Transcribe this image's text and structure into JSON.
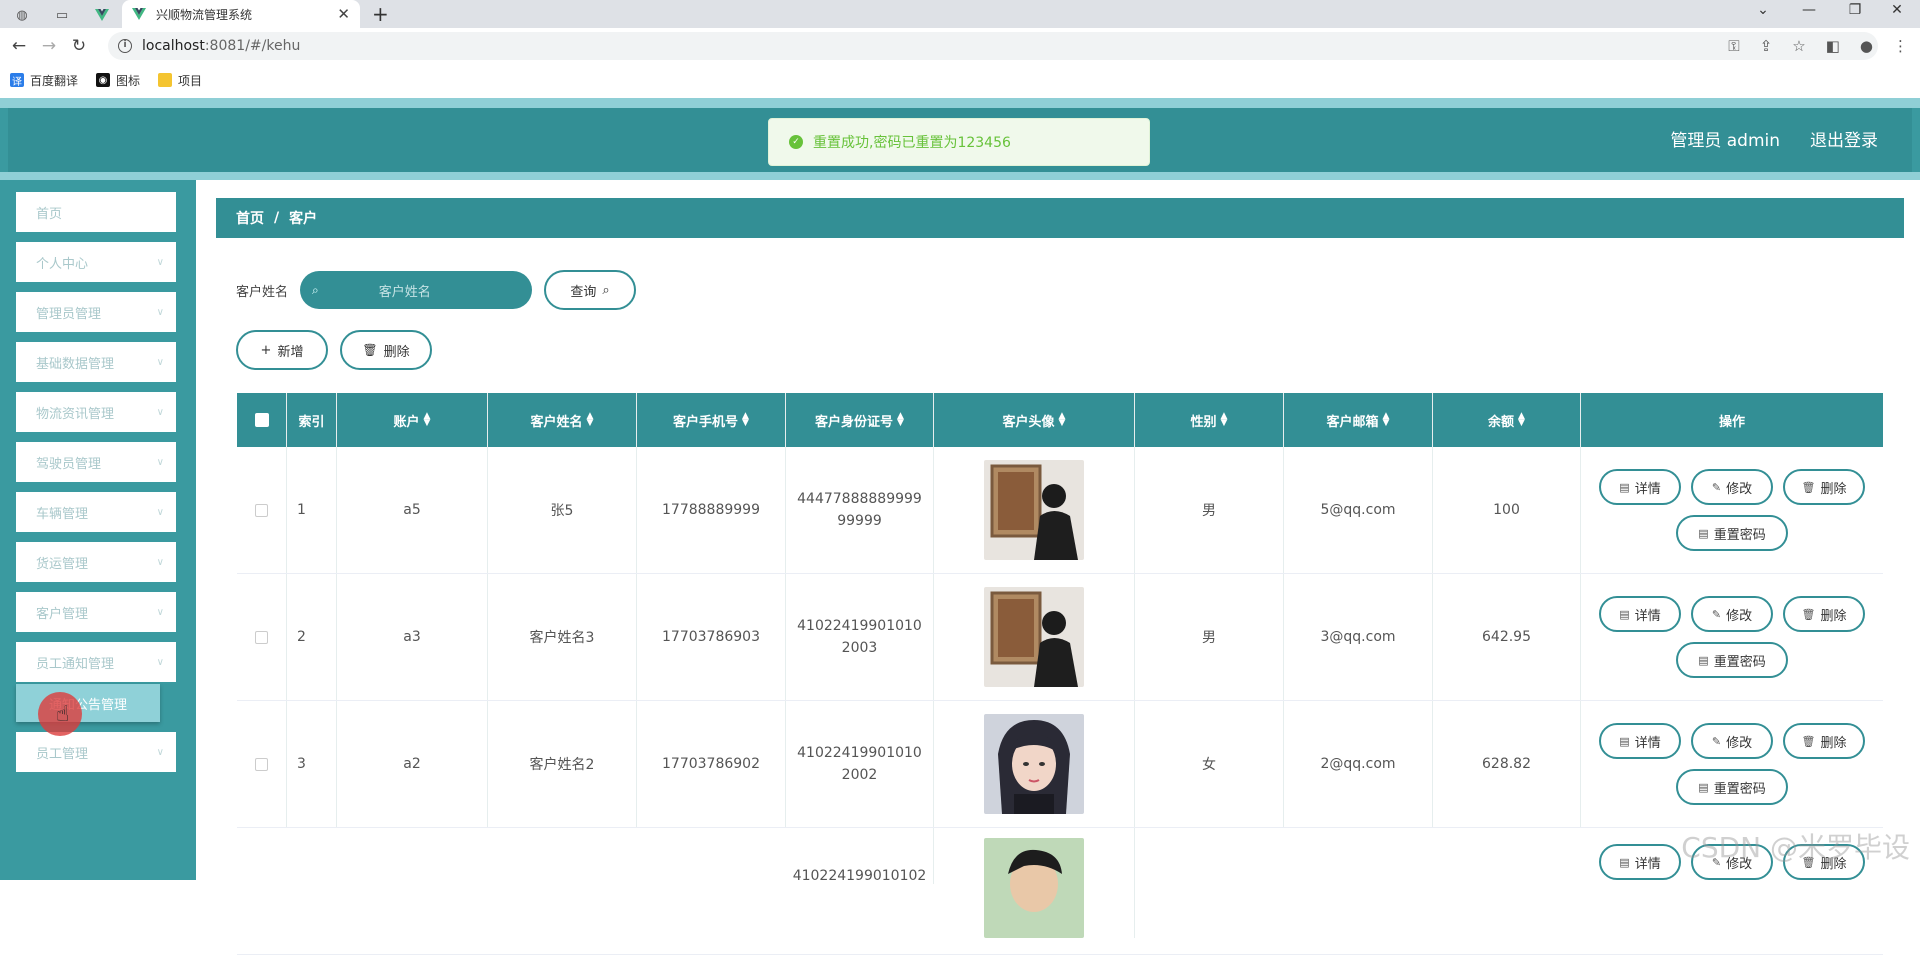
{
  "browser": {
    "tab_title": "兴顺物流管理系统",
    "url_host": "localhost",
    "url_rest": ":8081/#/kehu",
    "bookmarks": [
      "百度翻译",
      "图标",
      "项目"
    ]
  },
  "header": {
    "user_label": "管理员 admin",
    "logout_label": "退出登录"
  },
  "toast": {
    "message": "重置成功,密码已重置为123456"
  },
  "sidebar": {
    "items": [
      {
        "label": "首页"
      },
      {
        "label": "个人中心"
      },
      {
        "label": "管理员管理"
      },
      {
        "label": "基础数据管理"
      },
      {
        "label": "物流资讯管理"
      },
      {
        "label": "驾驶员管理"
      },
      {
        "label": "车辆管理"
      },
      {
        "label": "货运管理"
      },
      {
        "label": "客户管理"
      },
      {
        "label": "员工通知管理"
      },
      {
        "label": "员工管理"
      }
    ],
    "submenu_label": "通知公告管理"
  },
  "breadcrumb": {
    "home": "首页",
    "sep": "/",
    "current": "客户"
  },
  "search": {
    "label": "客户姓名",
    "placeholder": "客户姓名",
    "button": "查询"
  },
  "actions": {
    "add": "新增",
    "delete": "删除"
  },
  "table": {
    "headers": [
      "索引",
      "账户",
      "客户姓名",
      "客户手机号",
      "客户身份证号",
      "客户头像",
      "性别",
      "客户邮箱",
      "余额",
      "操作"
    ],
    "op_labels": {
      "detail": "详情",
      "edit": "修改",
      "delete": "删除",
      "reset": "重置密码"
    },
    "rows": [
      {
        "index": "1",
        "account": "a5",
        "name": "张5",
        "phone": "17788889999",
        "idcard": "4447788888999999999",
        "gender": "男",
        "email": "5@qq.com",
        "balance": "100"
      },
      {
        "index": "2",
        "account": "a3",
        "name": "客户姓名3",
        "phone": "17703786903",
        "idcard": "410224199010102003",
        "gender": "男",
        "email": "3@qq.com",
        "balance": "642.95"
      },
      {
        "index": "3",
        "account": "a2",
        "name": "客户姓名2",
        "phone": "17703786902",
        "idcard": "410224199010102002",
        "gender": "女",
        "email": "2@qq.com",
        "balance": "628.82"
      },
      {
        "index": "",
        "account": "",
        "name": "",
        "phone": "",
        "idcard": "410224199010102",
        "gender": "",
        "email": "",
        "balance": ""
      }
    ]
  },
  "watermark": "CSDN @米罗毕设",
  "colors": {
    "primary": "#338f95",
    "sidebar": "#3a9aa0",
    "success": "#67c23a"
  }
}
